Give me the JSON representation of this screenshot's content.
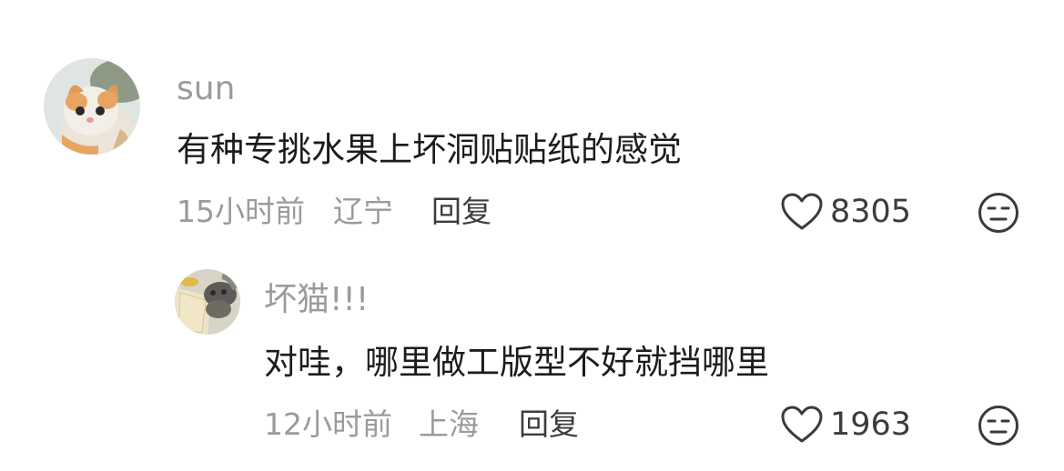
{
  "comments": [
    {
      "username": "sun",
      "text": "有种专挑水果上坏洞贴贴纸的感觉",
      "time": "15小时前",
      "location": "辽宁",
      "reply_label": "回复",
      "likes": "8305",
      "avatar_icon": "cat-avatar"
    },
    {
      "username": "坏猫!!!",
      "text": "对哇，哪里做工版型不好就挡哪里",
      "time": "12小时前",
      "location": "上海",
      "reply_label": "回复",
      "likes": "1963",
      "avatar_icon": "cat-photo-avatar"
    }
  ],
  "icons": {
    "like": "heart-icon",
    "dislike": "meh-face-icon"
  },
  "colors": {
    "primary_text": "#1c1c1c",
    "secondary_text": "#9b9b9b",
    "action_text": "#3c3c3c"
  }
}
